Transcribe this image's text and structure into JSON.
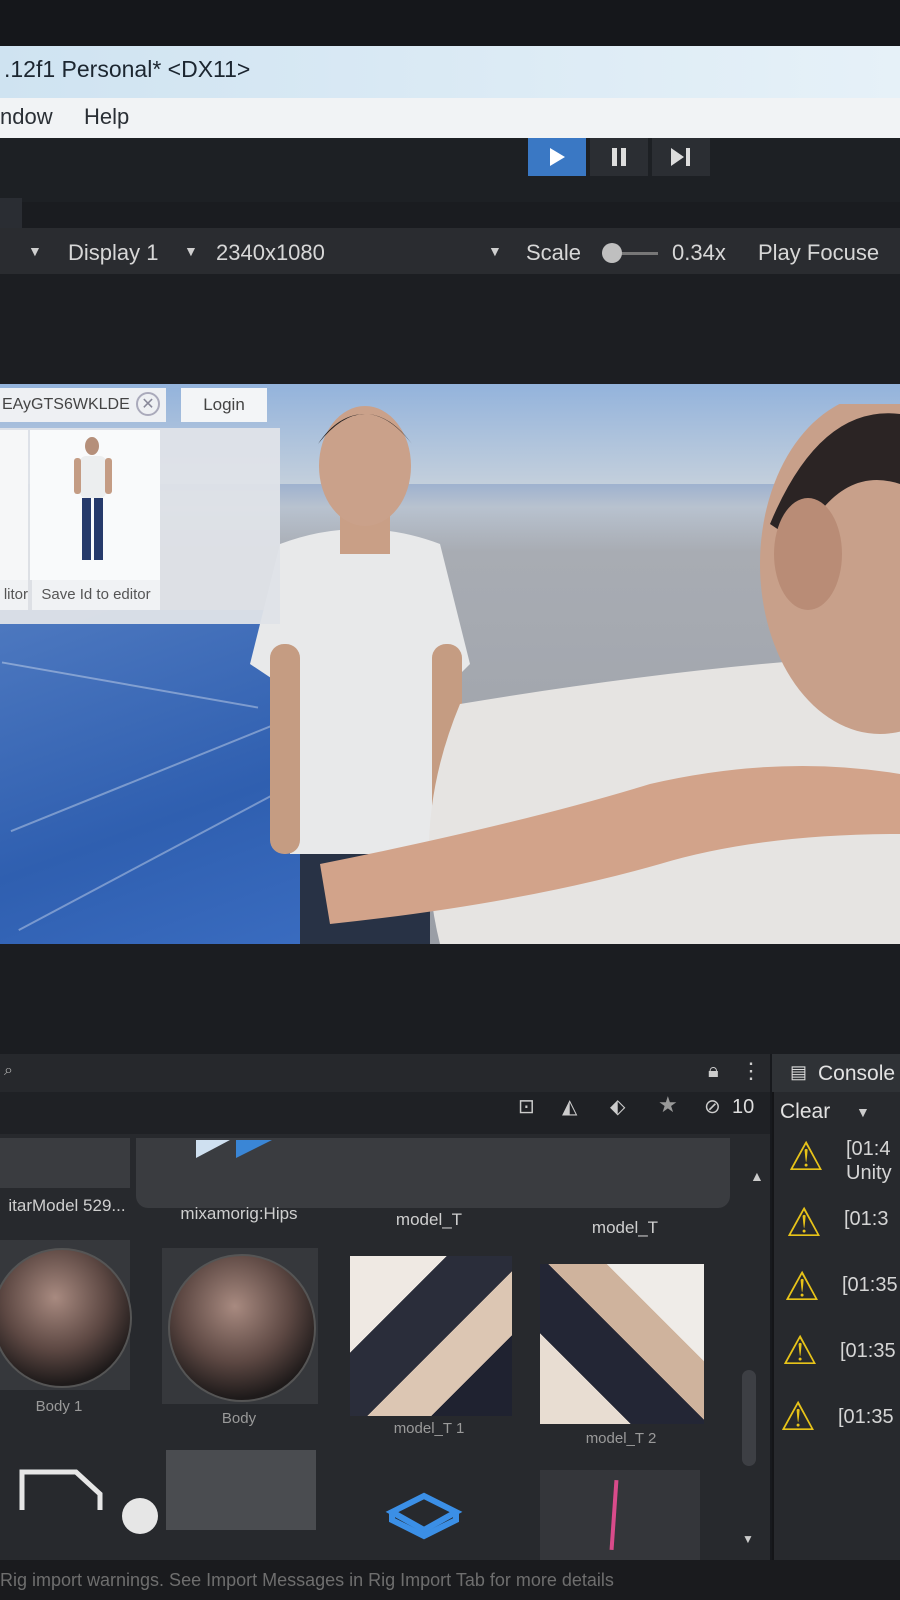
{
  "window": {
    "title": ".12f1 Personal* <DX11>"
  },
  "menu": {
    "items": [
      "ndow",
      "Help"
    ]
  },
  "toolbar": {
    "play_label": "▶",
    "pause_label": "❚❚",
    "step_label": "▶|",
    "accent": "#3a78c4"
  },
  "game_view": {
    "display": "Display 1",
    "resolution": "2340x1080",
    "scale_label": "Scale",
    "scale_value": "0.34x",
    "play_focus": "Play Focuse"
  },
  "game_ui": {
    "id_field_value": "EAyGTS6WKLDE",
    "login_label": "Login",
    "card_left_button": "litor",
    "save_button": "Save Id to editor"
  },
  "project": {
    "toolbar_count": "10",
    "row1": [
      "itarModel 529...",
      "mixamorig:Hips",
      "model_T",
      "model_T"
    ],
    "row2": [
      "Body 1",
      "Body",
      "model_T 1",
      "model_T 2"
    ]
  },
  "console": {
    "tab_label": "Console",
    "clear_label": "Clear",
    "entries": [
      {
        "time": "[01:4",
        "text": "Unity"
      },
      {
        "time": "[01:3",
        "text": ""
      },
      {
        "time": "[01:35",
        "text": ""
      },
      {
        "time": "[01:35",
        "text": ""
      },
      {
        "time": "[01:35",
        "text": ""
      }
    ],
    "warning_color": "#e7c319"
  },
  "status_bar": {
    "text": "Rig import warnings. See Import Messages in Rig Import Tab for more details"
  }
}
